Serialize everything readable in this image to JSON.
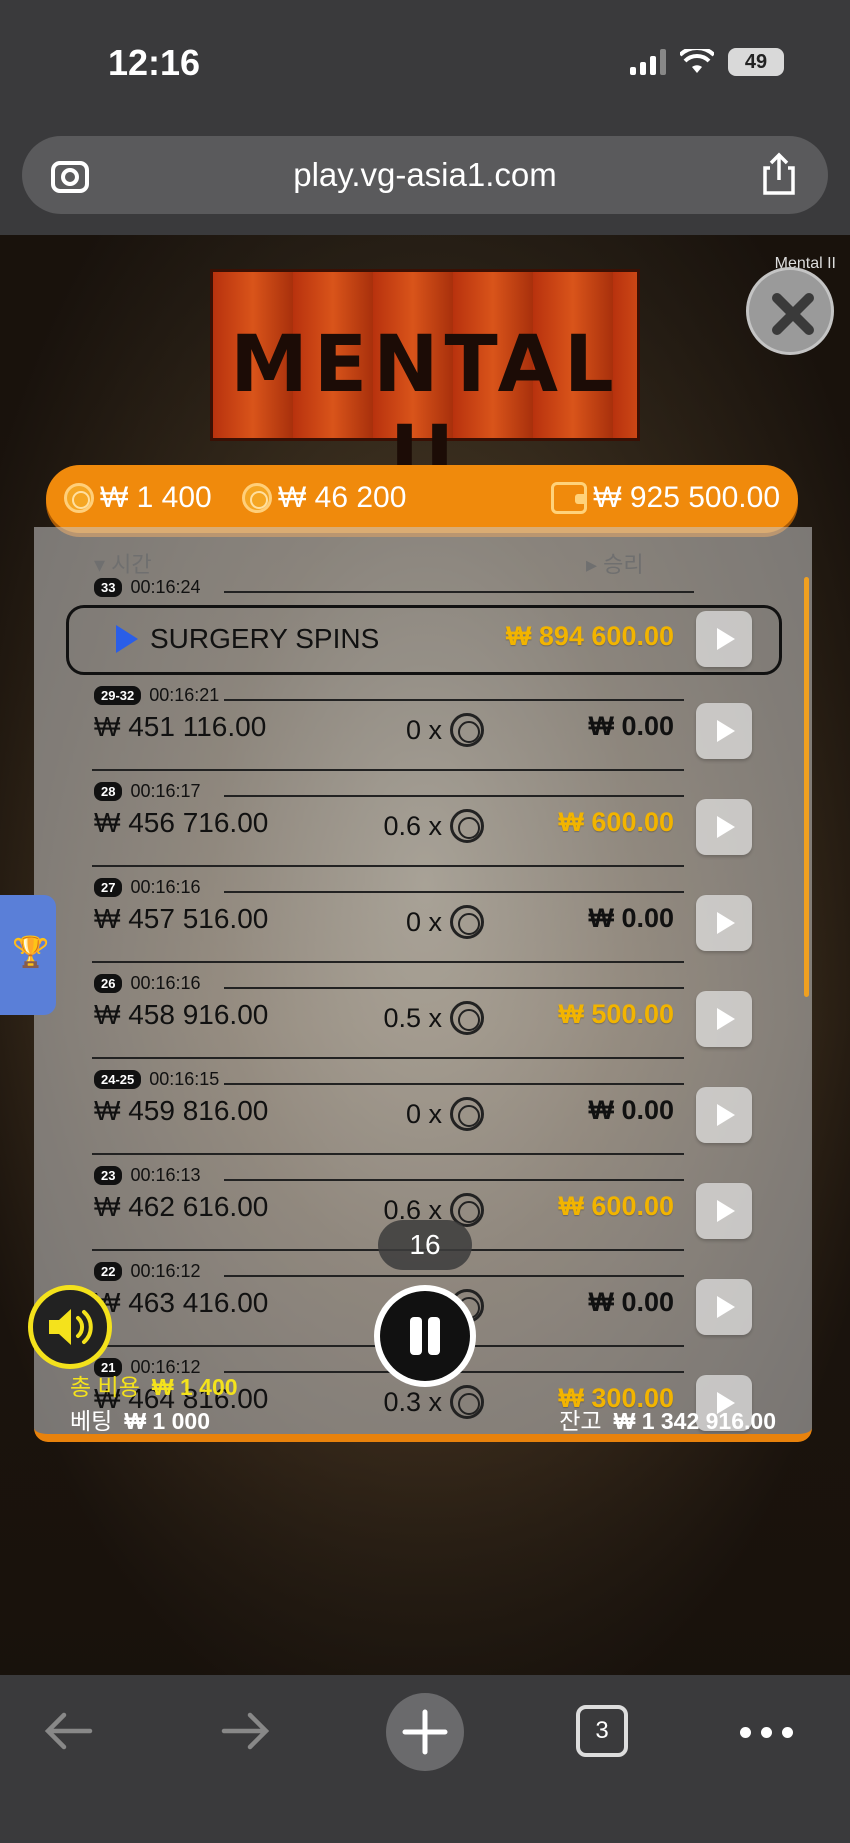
{
  "status_bar": {
    "time": "12:16",
    "battery": "49"
  },
  "browser": {
    "url": "play.vg-asia1.com",
    "tab_count": "3"
  },
  "game": {
    "caption": "Mental II",
    "logo": "MENTAL II",
    "stats": {
      "bet_cost": "₩ 1 400",
      "total_win": "₩ 46 200",
      "wallet": "₩ 925 500.00"
    },
    "headers": {
      "time": "시간",
      "win": "승리"
    },
    "history": [
      {
        "round": "33",
        "time": "00:16:24",
        "label": "SURGERY SPINS",
        "win": "₩ 894 600.00",
        "gold": true
      },
      {
        "round": "29-32",
        "time": "00:16:21",
        "balance": "₩ 451 116.00",
        "multiplier": "0 x",
        "win": "₩ 0.00",
        "gold": false
      },
      {
        "round": "28",
        "time": "00:16:17",
        "balance": "₩ 456 716.00",
        "multiplier": "0.6 x",
        "win": "₩ 600.00",
        "gold": true
      },
      {
        "round": "27",
        "time": "00:16:16",
        "balance": "₩ 457 516.00",
        "multiplier": "0 x",
        "win": "₩ 0.00",
        "gold": false
      },
      {
        "round": "26",
        "time": "00:16:16",
        "balance": "₩ 458 916.00",
        "multiplier": "0.5 x",
        "win": "₩ 500.00",
        "gold": true
      },
      {
        "round": "24-25",
        "time": "00:16:15",
        "balance": "₩ 459 816.00",
        "multiplier": "0 x",
        "win": "₩ 0.00",
        "gold": false
      },
      {
        "round": "23",
        "time": "00:16:13",
        "balance": "₩ 462 616.00",
        "multiplier": "0.6 x",
        "win": "₩ 600.00",
        "gold": true
      },
      {
        "round": "22",
        "time": "00:16:12",
        "balance": "₩ 463 416.00",
        "multiplier": "0 x",
        "win": "₩ 0.00",
        "gold": false
      },
      {
        "round": "21",
        "time": "00:16:12",
        "balance": "₩ 464 816.00",
        "multiplier": "0.3 x",
        "win": "₩ 300.00",
        "gold": true
      }
    ],
    "spin_counter": "16",
    "footer": {
      "cost_label": "총 비용",
      "cost_value": "₩ 1 400",
      "bet_label": "베팅",
      "bet_value": "₩ 1 000",
      "balance_label": "잔고",
      "balance_value": "₩ 1 342 916.00"
    }
  }
}
